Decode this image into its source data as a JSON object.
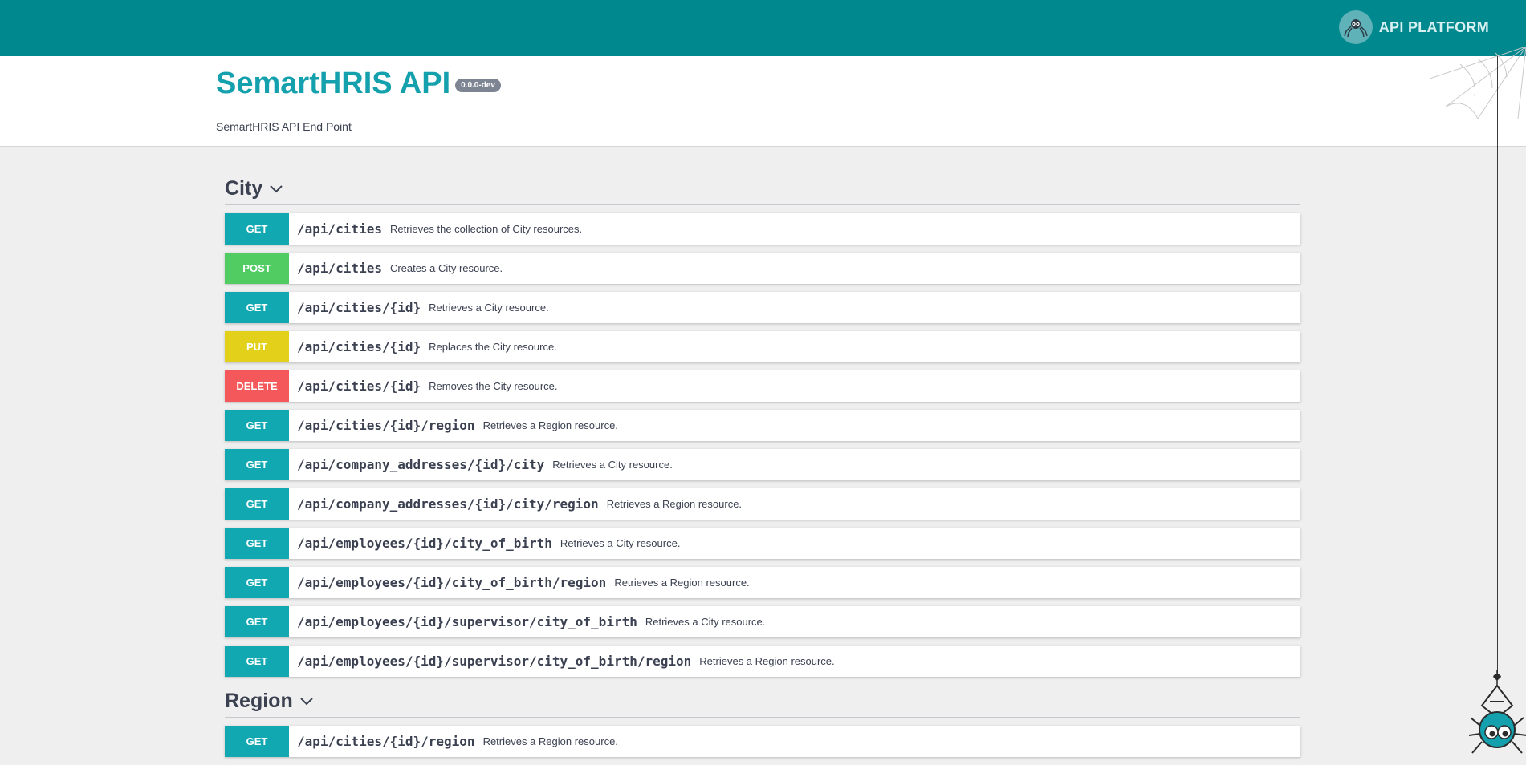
{
  "header": {
    "brand_label": "API PLATFORM",
    "brand_icon": "spider-logo-icon",
    "colors": {
      "topbar": "#00888f",
      "title": "#14a0ad"
    }
  },
  "info": {
    "title": "SemartHRIS API",
    "version": "0.0.0-dev",
    "description": "SemartHRIS API End Point"
  },
  "methods_colors": {
    "GET": "#12a8b2",
    "POST": "#50cc63",
    "PUT": "#e2d01a",
    "DELETE": "#f4585a"
  },
  "sections": [
    {
      "name": "City",
      "operations": [
        {
          "method": "GET",
          "path": "/api/cities",
          "summary": "Retrieves the collection of City resources."
        },
        {
          "method": "POST",
          "path": "/api/cities",
          "summary": "Creates a City resource."
        },
        {
          "method": "GET",
          "path": "/api/cities/{id}",
          "summary": "Retrieves a City resource."
        },
        {
          "method": "PUT",
          "path": "/api/cities/{id}",
          "summary": "Replaces the City resource."
        },
        {
          "method": "DELETE",
          "path": "/api/cities/{id}",
          "summary": "Removes the City resource."
        },
        {
          "method": "GET",
          "path": "/api/cities/{id}/region",
          "summary": "Retrieves a Region resource."
        },
        {
          "method": "GET",
          "path": "/api/company_addresses/{id}/city",
          "summary": "Retrieves a City resource."
        },
        {
          "method": "GET",
          "path": "/api/company_addresses/{id}/city/region",
          "summary": "Retrieves a Region resource."
        },
        {
          "method": "GET",
          "path": "/api/employees/{id}/city_of_birth",
          "summary": "Retrieves a City resource."
        },
        {
          "method": "GET",
          "path": "/api/employees/{id}/city_of_birth/region",
          "summary": "Retrieves a Region resource."
        },
        {
          "method": "GET",
          "path": "/api/employees/{id}/supervisor/city_of_birth",
          "summary": "Retrieves a City resource."
        },
        {
          "method": "GET",
          "path": "/api/employees/{id}/supervisor/city_of_birth/region",
          "summary": "Retrieves a Region resource."
        }
      ]
    },
    {
      "name": "Region",
      "operations": [
        {
          "method": "GET",
          "path": "/api/cities/{id}/region",
          "summary": "Retrieves a Region resource."
        }
      ]
    }
  ]
}
